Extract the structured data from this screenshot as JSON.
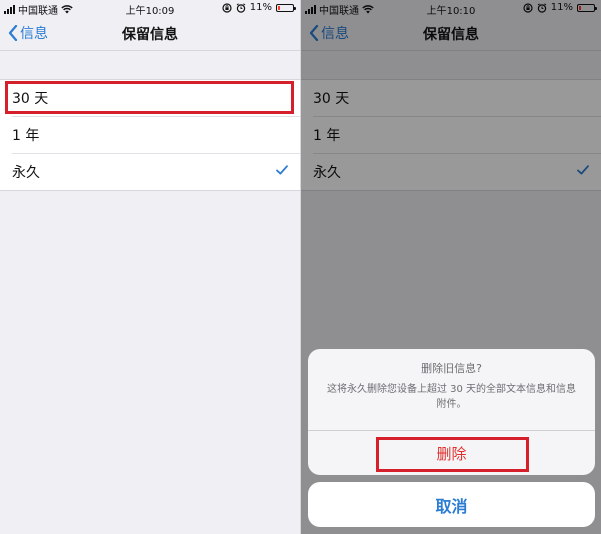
{
  "colors": {
    "accent": "#2b7cd3",
    "destructive": "#e2302c",
    "annotation": "#d5202b",
    "battery_low": "#ff3b30"
  },
  "left": {
    "status": {
      "carrier": "中国联通",
      "time": "上午10:09",
      "battery": "11%"
    },
    "nav": {
      "back_label": "信息",
      "title": "保留信息"
    },
    "options": [
      {
        "label": "30 天",
        "checked": false
      },
      {
        "label": "1 年",
        "checked": false
      },
      {
        "label": "永久",
        "checked": true
      }
    ]
  },
  "right": {
    "status": {
      "carrier": "中国联通",
      "time": "上午10:10",
      "battery": "11%"
    },
    "nav": {
      "back_label": "信息",
      "title": "保留信息"
    },
    "options": [
      {
        "label": "30 天",
        "checked": false
      },
      {
        "label": "1 年",
        "checked": false
      },
      {
        "label": "永久",
        "checked": true
      }
    ],
    "alert": {
      "title": "删除旧信息?",
      "message": "这将永久删除您设备上超过 30 天的全部文本信息和信息附件。",
      "delete_label": "删除",
      "cancel_label": "取消"
    }
  },
  "icons": {
    "signal": "signal-icon",
    "wifi": "wifi-icon",
    "rotation_lock": "rotation-lock-icon",
    "alarm": "alarm-icon",
    "battery": "battery-icon",
    "back": "chevron-left-icon",
    "check": "checkmark-icon"
  },
  "battery_level": 0.11
}
